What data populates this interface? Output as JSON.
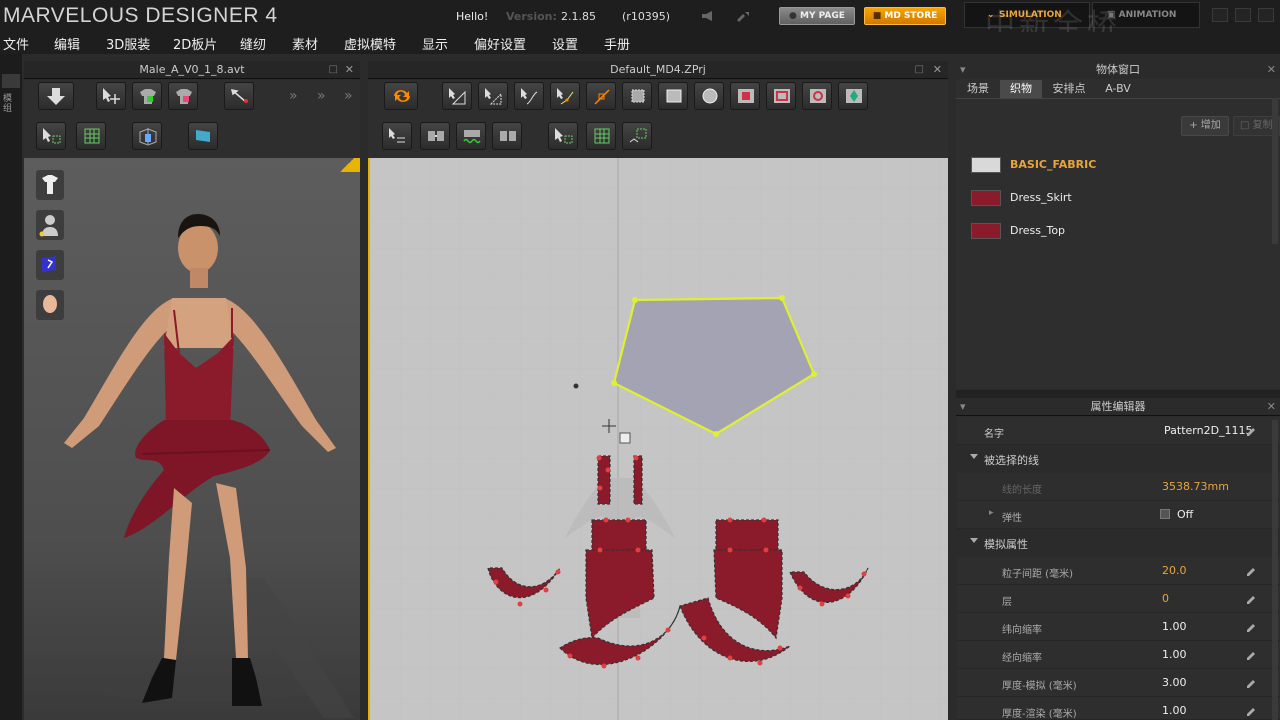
{
  "app": {
    "title": "MARVELOUS DESIGNER 4",
    "hello": "Hello!",
    "version_label": "Version:",
    "version": "2.1.85",
    "build": "(r10395)",
    "my_page": "MY PAGE",
    "md_store": "MD STORE",
    "mode_simulation": "SIMULATION",
    "mode_animation": "ANIMATION",
    "watermark": "中新全桥"
  },
  "menu": [
    "文件",
    "编辑",
    "3D服装",
    "2D板片",
    "缝纫",
    "素材",
    "虚拟模特",
    "显示",
    "偏好设置",
    "设置",
    "手册"
  ],
  "left_strip_label": "模组",
  "panel3d": {
    "title": "Male_A_V0_1_8.avt"
  },
  "panel2d": {
    "title": "Default_MD4.ZPrj"
  },
  "object_window": {
    "title": "物体窗口",
    "tabs": [
      "场景",
      "织物",
      "安排点",
      "A-BV"
    ],
    "active_tab": "织物",
    "add_button": "增加",
    "copy_button": "复制",
    "fabrics": [
      {
        "name": "BASIC_FABRIC",
        "color": "#d9d9d9",
        "selected": true
      },
      {
        "name": "Dress_Skirt",
        "color": "#8b1a2a",
        "selected": false
      },
      {
        "name": "Dress_Top",
        "color": "#8b1a2a",
        "selected": false
      }
    ]
  },
  "property_editor": {
    "title": "属性编辑器",
    "name_label": "名字",
    "name_value": "Pattern2D_1115",
    "selected_line_section": "被选择的线",
    "line_length_label": "线的长度",
    "line_length_value": "3538.73mm",
    "elastic_label": "弹性",
    "elastic_value": "Off",
    "sim_section": "模拟属性",
    "props": [
      {
        "label": "粒子间距 (毫米)",
        "value": "20.0",
        "highlight": true
      },
      {
        "label": "层",
        "value": "0",
        "highlight": true
      },
      {
        "label": "纬向缩率",
        "value": "1.00",
        "highlight": false
      },
      {
        "label": "经向缩率",
        "value": "1.00",
        "highlight": false
      },
      {
        "label": "厚度-模拟 (毫米)",
        "value": "3.00",
        "highlight": false
      },
      {
        "label": "厚度-渲染 (毫米)",
        "value": "1.00",
        "highlight": false
      }
    ]
  },
  "colors": {
    "accent": "#e9a33c",
    "pattern_red": "#8b1a2a",
    "selection_yellow": "#e0f030",
    "store_orange": "#f0a000"
  }
}
